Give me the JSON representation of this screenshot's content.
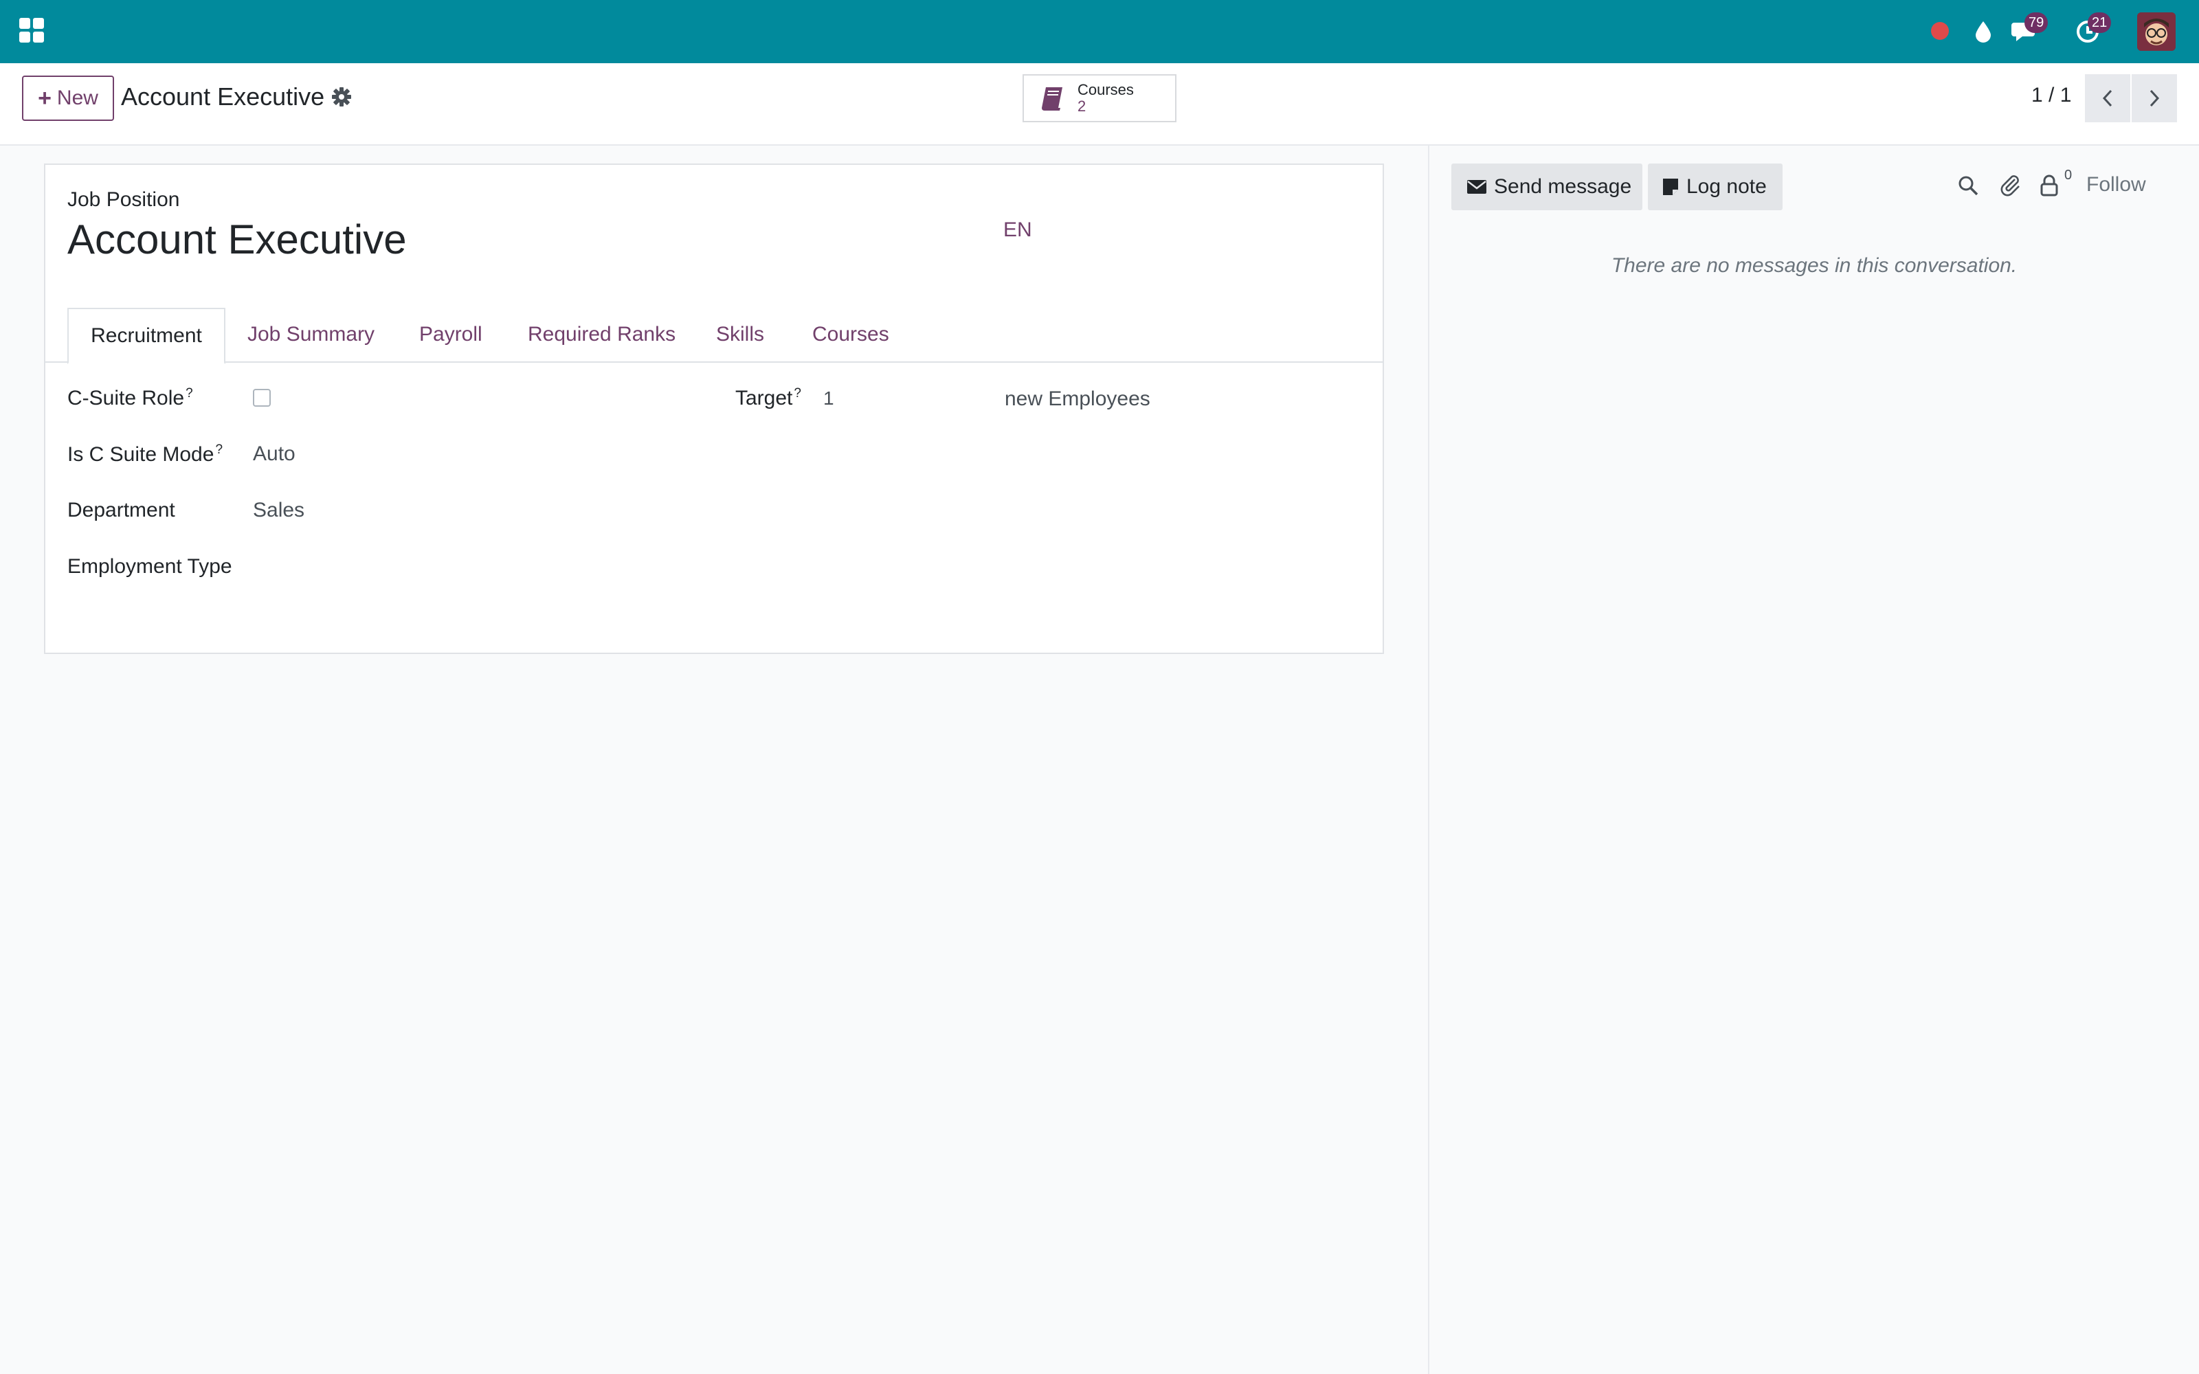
{
  "topbar": {
    "chat_badge": "79",
    "activity_badge": "21",
    "colors": {
      "bar": "#018a9c",
      "badge": "#6f2f63",
      "record": "#e04a4a"
    }
  },
  "controlbar": {
    "new_label": "New",
    "breadcrumb": "Account Executive",
    "smart_button": {
      "label": "Courses",
      "value": "2"
    },
    "pager": "1 / 1"
  },
  "form": {
    "overline": "Job Position",
    "title": "Account Executive",
    "lang": "EN",
    "tabs": [
      {
        "label": "Recruitment",
        "active": true
      },
      {
        "label": "Job Summary",
        "active": false
      },
      {
        "label": "Payroll",
        "active": false
      },
      {
        "label": "Required Ranks",
        "active": false
      },
      {
        "label": "Skills",
        "active": false
      },
      {
        "label": "Courses",
        "active": false
      }
    ],
    "fields": {
      "c_suite_role": {
        "label": "C-Suite Role",
        "help": "?",
        "checked": false
      },
      "is_c_suite_mode": {
        "label": "Is C Suite Mode",
        "help": "?",
        "value": "Auto"
      },
      "department": {
        "label": "Department",
        "value": "Sales"
      },
      "employment_type": {
        "label": "Employment Type",
        "value": ""
      },
      "target": {
        "label": "Target",
        "help": "?",
        "value": "1",
        "unit": "new Employees"
      }
    },
    "accent_color": "#71406b"
  },
  "chatter": {
    "send_message": "Send message",
    "log_note": "Log note",
    "follower_count": "0",
    "follow": "Follow",
    "empty": "There are no messages in this conversation."
  }
}
